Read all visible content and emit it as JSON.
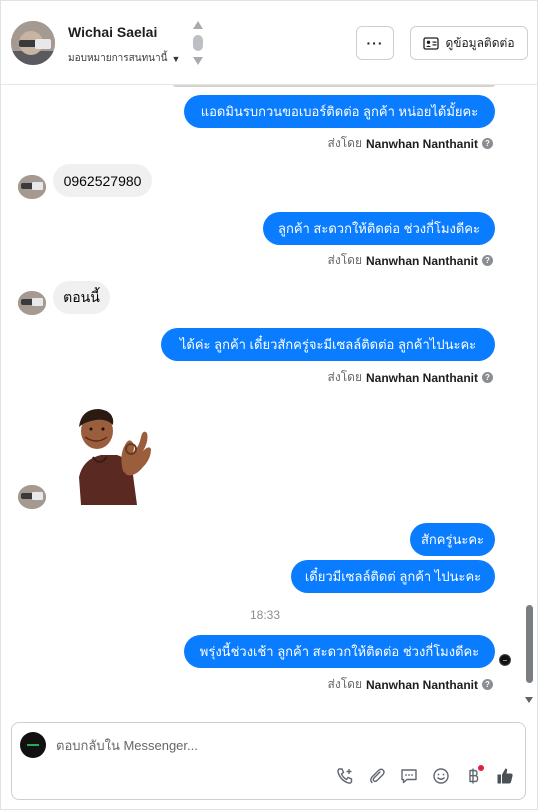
{
  "header": {
    "contact_name": "Wichai Saelai",
    "assign_label": "มอบหมายการสนทนานี้",
    "contact_details_label": "ดูข้อมูลติดต่อ"
  },
  "messages": [
    {
      "direction": "outgoing",
      "text": "แอดมินรบกวนขอเบอร์ติดต่อ ลูกค้า หน่อยได้มั้ยคะ"
    },
    {
      "direction": "incoming",
      "text": "0962527980"
    },
    {
      "direction": "outgoing",
      "text": "ลูกค้า สะดวกให้ติดต่อ ช่วงกี่โมงดีคะ"
    },
    {
      "direction": "incoming",
      "text": "ตอนนี้"
    },
    {
      "direction": "outgoing",
      "text": "ได้ค่ะ  ลูกค้า เดี๋ยวสักครู่จะมีเซลล์ติดต่อ ลูกค้าไปนะคะ"
    },
    {
      "direction": "incoming",
      "type": "sticker",
      "sticker": "ok-gesture-sticker"
    },
    {
      "direction": "outgoing",
      "text": "สักครู่นะคะ"
    },
    {
      "direction": "outgoing",
      "text": "เดี๋ยวมีเซลล์ติดต่ ลูกค้า ไปนะคะ"
    },
    {
      "direction": "outgoing",
      "text": "พรุ่งนี้ช่วงเช้า ลูกค้า สะดวกให้ติดต่อ ช่วงกี่โมงดีคะ"
    }
  ],
  "sent_by": {
    "prefix": "ส่งโดย",
    "name": "Nanwhan Nanthanit"
  },
  "timestamp": "18:33",
  "composer": {
    "placeholder": "ตอบกลับใน Messenger..."
  },
  "icons": {
    "more": "more-horizontal-icon",
    "contact_card": "contact-card-icon",
    "help": "help-circle-icon",
    "call": "call-add-icon",
    "attach": "paperclip-icon",
    "saved_replies": "chat-bubble-icon",
    "emoji": "emoji-icon",
    "payment": "baht-icon",
    "like": "thumbs-up-icon"
  },
  "colors": {
    "outgoing_bubble": "#0a7cff",
    "incoming_bubble": "#f0f0f0",
    "notification_dot": "#e41e3f"
  }
}
